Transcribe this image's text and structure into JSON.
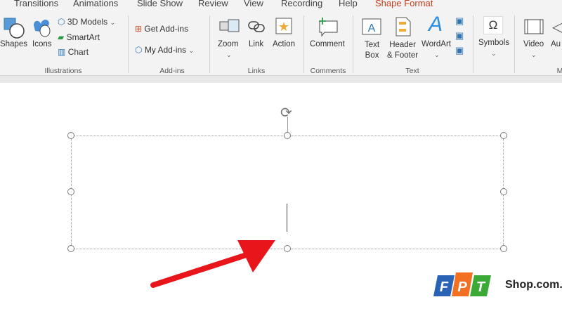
{
  "tabs": [
    "Transitions",
    "Animations",
    "Slide Show",
    "Review",
    "View",
    "Recording",
    "Help",
    "Shape Format"
  ],
  "ribbon": {
    "illustrations": {
      "shapes": "Shapes",
      "icons": "Icons",
      "models": "3D Models",
      "smartart": "SmartArt",
      "chart": "Chart",
      "group": "Illustrations"
    },
    "addins": {
      "get": "Get Add-ins",
      "my": "My Add-ins",
      "group": "Add-ins"
    },
    "links": {
      "zoom": "Zoom",
      "link": "Link",
      "action": "Action",
      "group": "Links"
    },
    "comments": {
      "comment": "Comment",
      "group": "Comments"
    },
    "text": {
      "textbox1": "Text",
      "textbox2": "Box",
      "header1": "Header",
      "header2": "& Footer",
      "wordart": "WordArt",
      "group": "Text"
    },
    "symbols": {
      "symbols": "Symbols"
    },
    "media": {
      "video": "Video",
      "audio": "Au",
      "group": "M"
    }
  },
  "watermark": {
    "brand": "FPT",
    "site": "Shop.com.vn"
  },
  "colors": {
    "accent": "#c43e1c",
    "arrow": "#e8151b"
  }
}
